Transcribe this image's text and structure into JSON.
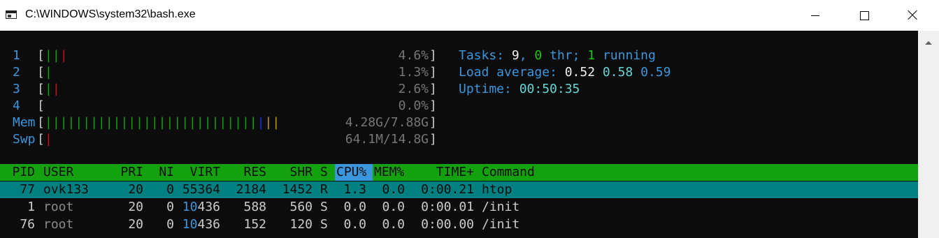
{
  "window": {
    "title": "C:\\WINDOWS\\system32\\bash.exe"
  },
  "meters": [
    {
      "label": "1",
      "value": "4.6%",
      "bars": [
        {
          "t": "|",
          "c": "green"
        },
        {
          "t": "|",
          "c": "green"
        },
        {
          "t": "|",
          "c": "red"
        }
      ]
    },
    {
      "label": "2",
      "value": "1.3%",
      "bars": [
        {
          "t": "|",
          "c": "green"
        }
      ]
    },
    {
      "label": "3",
      "value": "2.6%",
      "bars": [
        {
          "t": "|",
          "c": "green"
        },
        {
          "t": "|",
          "c": "red"
        }
      ]
    },
    {
      "label": "4",
      "value": "0.0%",
      "bars": []
    },
    {
      "label": "Mem",
      "value": "4.28G/7.88G",
      "bars": "mem"
    },
    {
      "label": "Swp",
      "value": "64.1M/14.8G",
      "bars": [
        {
          "t": "|",
          "c": "red"
        }
      ]
    }
  ],
  "mem_bar_counts": {
    "green": 28,
    "blue": 1,
    "yellow": 2
  },
  "summary": {
    "tasks_label": "Tasks: ",
    "tasks_count": "9",
    "tasks_sep": ", ",
    "threads_count": "0",
    "threads_label": " thr; ",
    "running_count": "1",
    "running_label": " running",
    "load_label": "Load average: ",
    "load_1": "0.52",
    "load_5": "0.58",
    "load_15": "0.59",
    "uptime_label": "Uptime: ",
    "uptime_value": "00:50:35"
  },
  "columns": [
    "PID",
    "USER",
    "PRI",
    "NI",
    "VIRT",
    "RES",
    "SHR",
    "S",
    "CPU%",
    "MEM%",
    "TIME+",
    "Command"
  ],
  "processes": [
    {
      "pid": "77",
      "user": "ovk133",
      "pri": "20",
      "ni": "0",
      "virt_a": "",
      "virt_b": "55364",
      "res": "2184",
      "shr": "1452",
      "s": "R",
      "cpu": "1.3",
      "mem": "0.0",
      "time": "0:00.21",
      "cmd": "htop",
      "selected": true
    },
    {
      "pid": "1",
      "user": "root",
      "pri": "20",
      "ni": "0",
      "virt_a": "10",
      "virt_b": "436",
      "res": "588",
      "shr": "560",
      "s": "S",
      "cpu": "0.0",
      "mem": "0.0",
      "time": "0:00.01",
      "cmd": "/init",
      "selected": false
    },
    {
      "pid": "76",
      "user": "root",
      "pri": "20",
      "ni": "0",
      "virt_a": "10",
      "virt_b": "436",
      "res": "152",
      "shr": "120",
      "s": "S",
      "cpu": "0.0",
      "mem": "0.0",
      "time": "0:00.00",
      "cmd": "/init",
      "selected": false
    }
  ],
  "colors": {
    "terminal_bg": "#0c0c0c",
    "header_bg": "#13a10e",
    "selected_bg": "#008080",
    "cpu_col_bg": "#3a96dd"
  },
  "icons": {
    "app": "console-icon",
    "minimize": "minimize-icon",
    "maximize": "maximize-icon",
    "close": "close-icon",
    "scroll_up": "scroll-up-arrow-icon"
  }
}
